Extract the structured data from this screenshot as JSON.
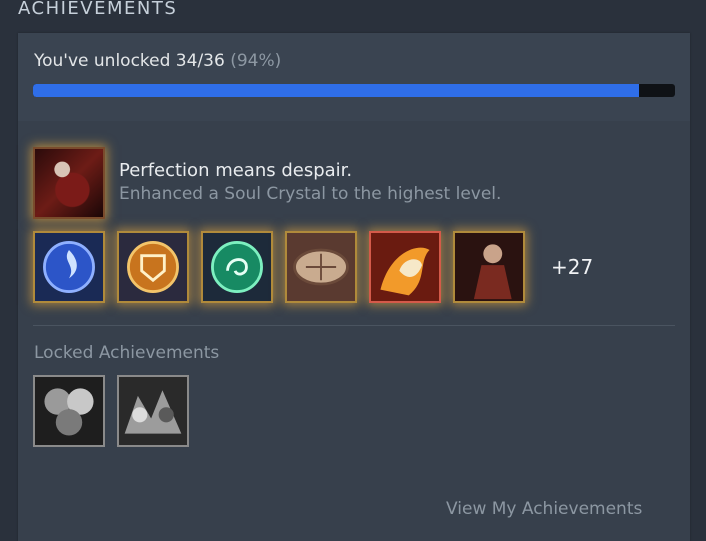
{
  "section": {
    "title": "ACHIEVEMENTS"
  },
  "progress": {
    "unlocked_text": "You've unlocked 34/36",
    "percent_text": "(94%)",
    "fraction": 0.944
  },
  "featured": {
    "title": "Perfection means despair.",
    "description": "Enhanced a Soul Crystal to the highest level.",
    "icon": "red-cloaked-warrior-icon"
  },
  "unlocked_icons": [
    {
      "name": "blue-flame-orb-icon"
    },
    {
      "name": "gold-shield-orb-icon"
    },
    {
      "name": "green-swirl-orb-icon"
    },
    {
      "name": "stone-relic-icon"
    },
    {
      "name": "fire-mask-icon"
    },
    {
      "name": "warrior-portrait-icon"
    }
  ],
  "more_count": "+27",
  "locked": {
    "label": "Locked Achievements",
    "icons": [
      {
        "name": "locked-orbs-icon"
      },
      {
        "name": "locked-battle-scene-icon"
      }
    ]
  },
  "view_link": "View My Achievements",
  "colors": {
    "progress_fill": "#2f6ee8",
    "glow": "#ecaa3c",
    "panel": "#37404c",
    "background": "#2a313c"
  }
}
